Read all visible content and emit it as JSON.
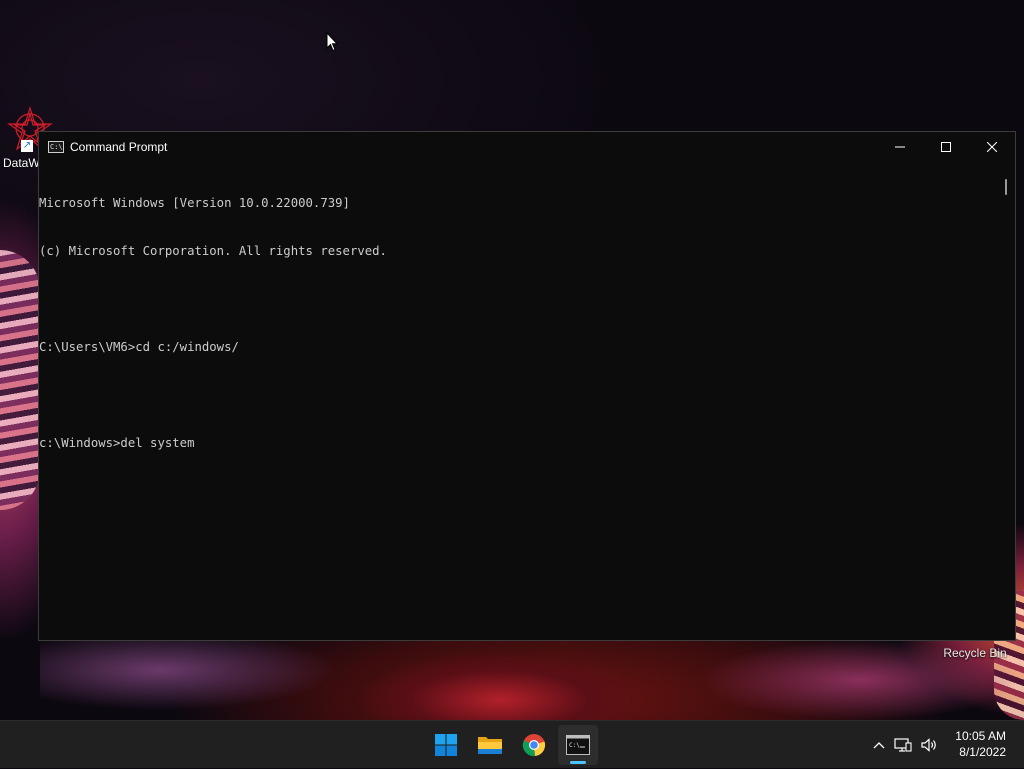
{
  "desktop": {
    "icons": [
      {
        "label": "DataW"
      },
      {
        "label": "Recycle Bin"
      }
    ]
  },
  "window": {
    "title": "Command Prompt",
    "console_lines": [
      "Microsoft Windows [Version 10.0.22000.739]",
      "(c) Microsoft Corporation. All rights reserved.",
      "",
      "C:\\Users\\VM6>cd c:/windows/",
      "",
      "c:\\Windows>del system"
    ],
    "colors": {
      "background": "#0c0c0c",
      "text": "#cccccc"
    }
  },
  "taskbar": {
    "apps": [
      {
        "name": "start-icon"
      },
      {
        "name": "file-explorer-icon"
      },
      {
        "name": "chrome-icon"
      },
      {
        "name": "command-prompt-icon",
        "active": true
      }
    ],
    "clock": {
      "time": "10:05 AM",
      "date": "8/1/2022"
    },
    "accent": "#4cc2ff"
  }
}
